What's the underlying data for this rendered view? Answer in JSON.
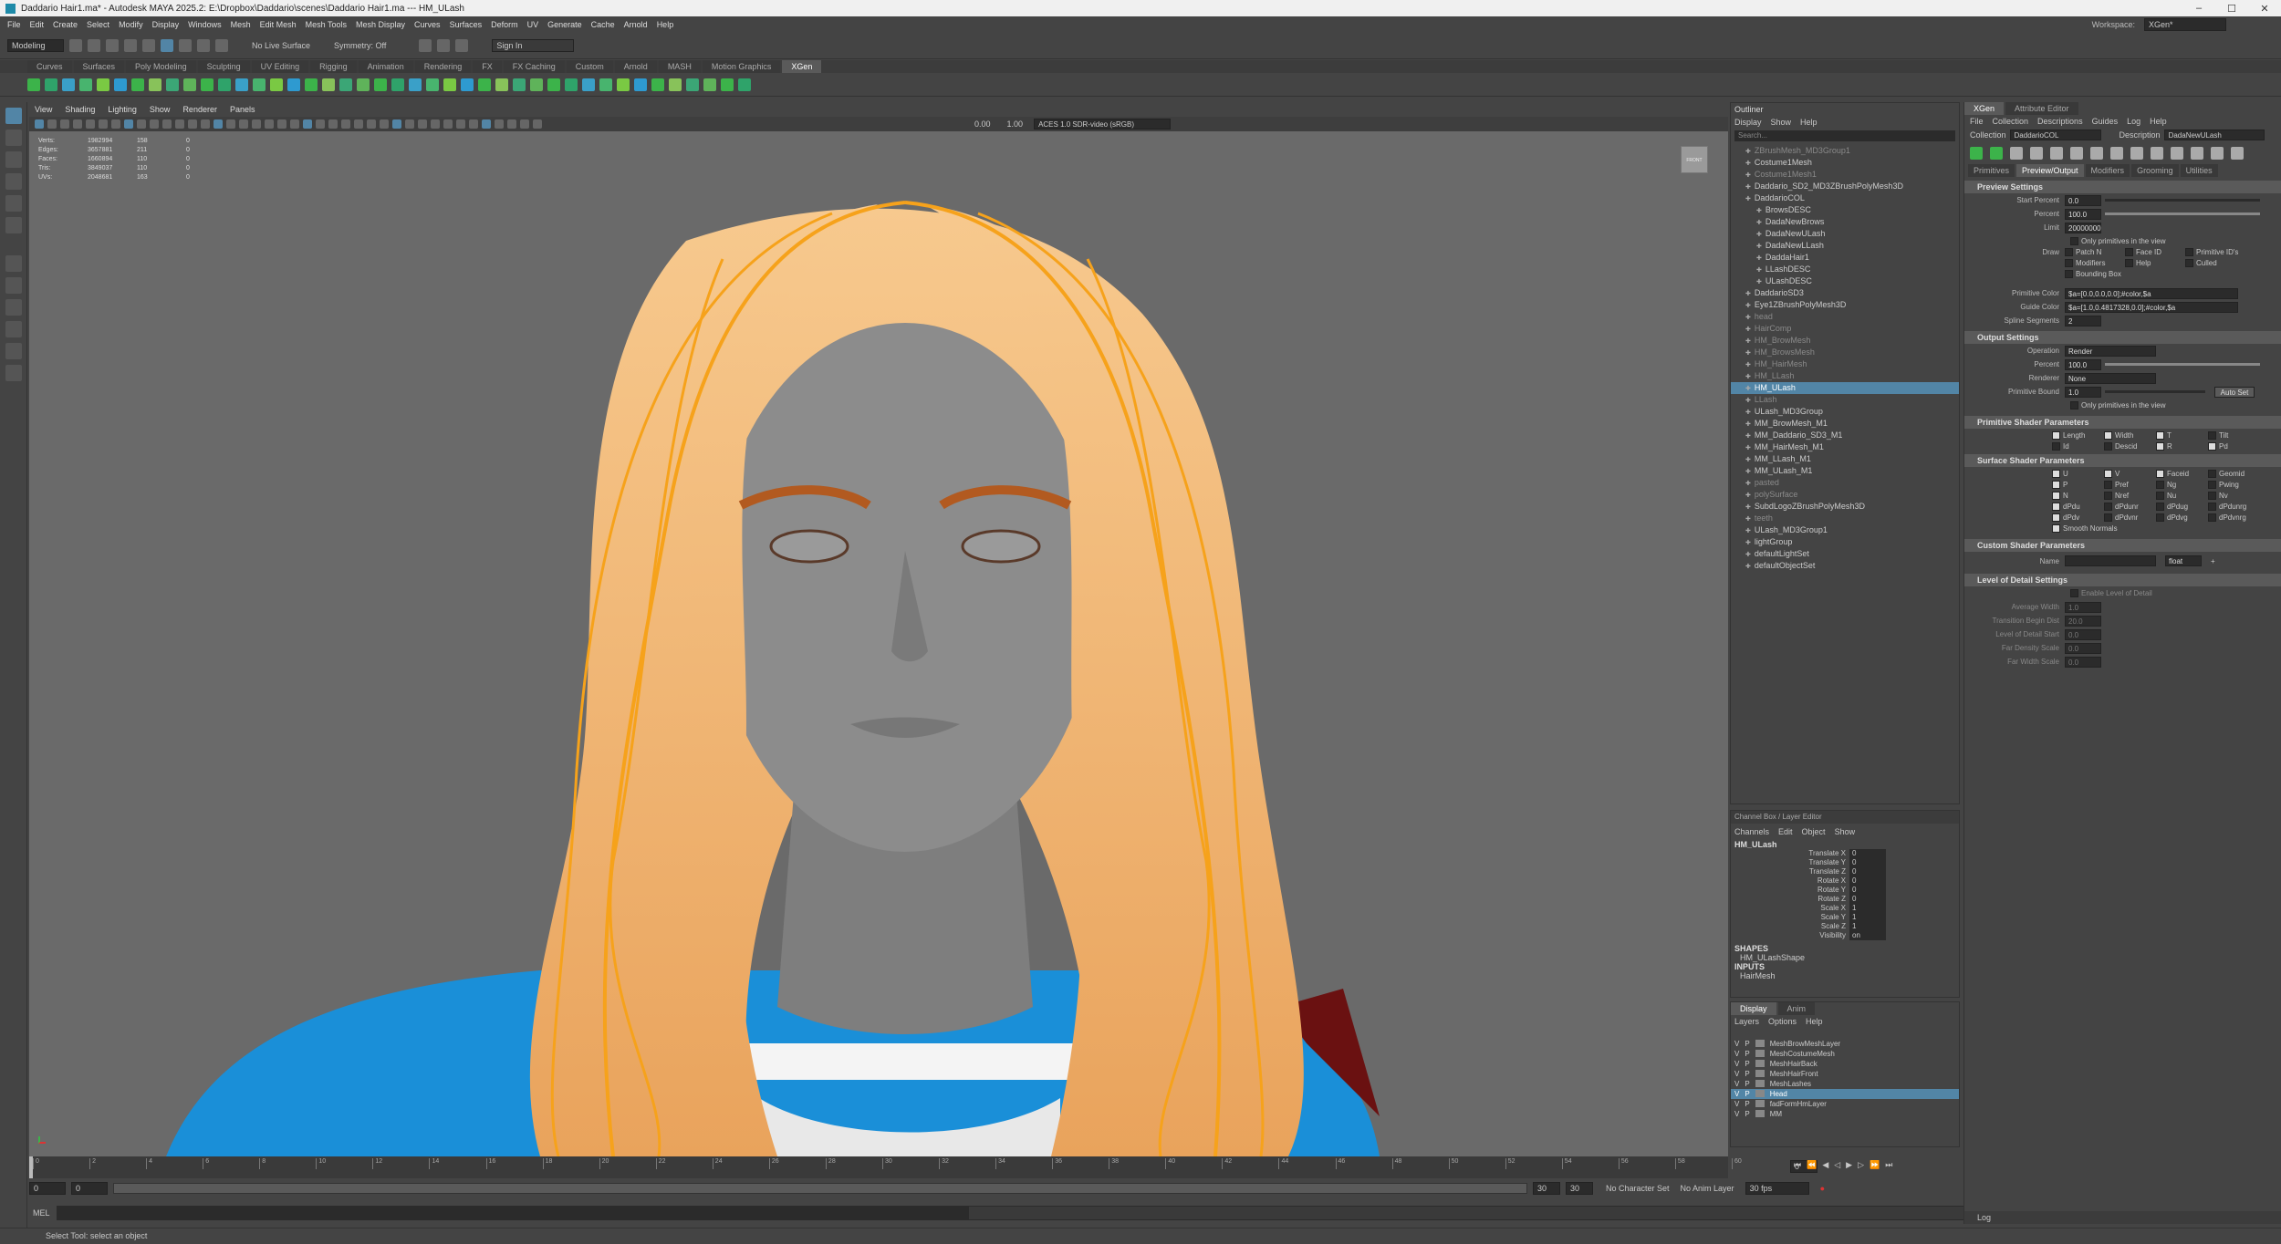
{
  "window": {
    "title": "Daddario Hair1.ma* - Autodesk MAYA 2025.2: E:\\Dropbox\\Daddario\\scenes\\Daddario Hair1.ma --- HM_ULash",
    "min": "–",
    "max": "☐",
    "close": "✕"
  },
  "menubar": {
    "items": [
      "File",
      "Edit",
      "Create",
      "Select",
      "Modify",
      "Display",
      "Windows",
      "Mesh",
      "Edit Mesh",
      "Mesh Tools",
      "Mesh Display",
      "Curves",
      "Surfaces",
      "Deform",
      "UV",
      "Generate",
      "Cache",
      "Arnold",
      "Help"
    ],
    "workspace_label": "Workspace:",
    "workspace_value": "XGen*"
  },
  "statusline": {
    "mode": "Modeling",
    "live": "No Live Surface",
    "symmetry": "Symmetry: Off",
    "user": "Sign In"
  },
  "shelf_tabs": [
    "Curves",
    "Surfaces",
    "Poly Modeling",
    "Sculpting",
    "UV Editing",
    "Rigging",
    "Animation",
    "Rendering",
    "FX",
    "FX Caching",
    "Custom",
    "Arnold",
    "MASH",
    "Motion Graphics",
    "XGen"
  ],
  "shelf_active": "XGen",
  "panel_menu": [
    "View",
    "Shading",
    "Lighting",
    "Show",
    "Renderer",
    "Panels"
  ],
  "panel_toolbar": {
    "val1": "0.00",
    "val2": "1.00",
    "colorspace": "ACES 1.0 SDR-video (sRGB)"
  },
  "hud": [
    [
      "Verts:",
      "1982994",
      "158",
      "0"
    ],
    [
      "Edges:",
      "3657881",
      "211",
      "0"
    ],
    [
      "Faces:",
      "1660894",
      "110",
      "0"
    ],
    [
      "Tris:",
      "3849037",
      "110",
      "0"
    ],
    [
      "UVs:",
      "2048681",
      "163",
      "0"
    ]
  ],
  "viewcube": "FRONT",
  "timeline": {
    "ticks": [
      "0",
      "2",
      "4",
      "6",
      "8",
      "10",
      "12",
      "14",
      "16",
      "18",
      "20",
      "22",
      "24",
      "26",
      "28",
      "30",
      "32",
      "34",
      "36",
      "38",
      "40",
      "42",
      "44",
      "46",
      "48",
      "50",
      "52",
      "54",
      "56",
      "58",
      "60"
    ],
    "current": "0",
    "start": "0",
    "start2": "0",
    "end": "30",
    "end2": "30",
    "charset": "No Character Set",
    "anim": "No Anim Layer",
    "fps": "30 fps"
  },
  "mel": {
    "label": "MEL"
  },
  "helpline": "Select Tool: select an object",
  "outliner": {
    "title": "Outliner",
    "menu": [
      "Display",
      "Show",
      "Help"
    ],
    "search": "Search...",
    "items": [
      {
        "t": "ZBrushMesh_MD3Group1",
        "d": 1,
        "c": "dim"
      },
      {
        "t": "Costume1Mesh",
        "d": 1,
        "c": ""
      },
      {
        "t": "Costume1Mesh1",
        "d": 1,
        "c": "dim"
      },
      {
        "t": "Daddario_SD2_MD3ZBrushPolyMesh3D",
        "d": 1,
        "c": ""
      },
      {
        "t": "DaddarioCOL",
        "d": 1,
        "c": ""
      },
      {
        "t": "BrowsDESC",
        "d": 2,
        "c": ""
      },
      {
        "t": "DadaNewBrows",
        "d": 2,
        "c": ""
      },
      {
        "t": "DadaNewULash",
        "d": 2,
        "c": ""
      },
      {
        "t": "DadaNewLLash",
        "d": 2,
        "c": ""
      },
      {
        "t": "DaddaHair1",
        "d": 2,
        "c": ""
      },
      {
        "t": "LLashDESC",
        "d": 2,
        "c": ""
      },
      {
        "t": "ULashDESC",
        "d": 2,
        "c": ""
      },
      {
        "t": "DaddarioSD3",
        "d": 1,
        "c": ""
      },
      {
        "t": "Eye1ZBrushPolyMesh3D",
        "d": 1,
        "c": ""
      },
      {
        "t": "head",
        "d": 1,
        "c": "dim"
      },
      {
        "t": "HairComp",
        "d": 1,
        "c": "dim"
      },
      {
        "t": "HM_BrowMesh",
        "d": 1,
        "c": "dim"
      },
      {
        "t": "HM_BrowsMesh",
        "d": 1,
        "c": "dim"
      },
      {
        "t": "HM_HairMesh",
        "d": 1,
        "c": "dim"
      },
      {
        "t": "HM_LLash",
        "d": 1,
        "c": "dim"
      },
      {
        "t": "HM_ULash",
        "d": 1,
        "c": "sel"
      },
      {
        "t": "LLash",
        "d": 1,
        "c": "dim"
      },
      {
        "t": "ULash_MD3Group",
        "d": 1,
        "c": ""
      },
      {
        "t": "MM_BrowMesh_M1",
        "d": 1,
        "c": ""
      },
      {
        "t": "MM_Daddario_SD3_M1",
        "d": 1,
        "c": ""
      },
      {
        "t": "MM_HairMesh_M1",
        "d": 1,
        "c": ""
      },
      {
        "t": "MM_LLash_M1",
        "d": 1,
        "c": ""
      },
      {
        "t": "MM_ULash_M1",
        "d": 1,
        "c": ""
      },
      {
        "t": "pasted",
        "d": 1,
        "c": "dim"
      },
      {
        "t": "polySurface",
        "d": 1,
        "c": "dim"
      },
      {
        "t": "SubdLogoZBrushPolyMesh3D",
        "d": 1,
        "c": ""
      },
      {
        "t": "teeth",
        "d": 1,
        "c": "dim"
      },
      {
        "t": "ULash_MD3Group1",
        "d": 1,
        "c": ""
      },
      {
        "t": "lightGroup",
        "d": 1,
        "c": ""
      },
      {
        "t": "defaultLightSet",
        "d": 1,
        "c": ""
      },
      {
        "t": "defaultObjectSet",
        "d": 1,
        "c": ""
      }
    ]
  },
  "channelbox": {
    "header": "Channel Box / Layer Editor",
    "menu": [
      "Channels",
      "Edit",
      "Object",
      "Show"
    ],
    "object": "HM_ULash",
    "channels": [
      [
        "Translate X",
        "0"
      ],
      [
        "Translate Y",
        "0"
      ],
      [
        "Translate Z",
        "0"
      ],
      [
        "Rotate X",
        "0"
      ],
      [
        "Rotate Y",
        "0"
      ],
      [
        "Rotate Z",
        "0"
      ],
      [
        "Scale X",
        "1"
      ],
      [
        "Scale Y",
        "1"
      ],
      [
        "Scale Z",
        "1"
      ],
      [
        "Visibility",
        "on"
      ]
    ],
    "shapes_label": "SHAPES",
    "shape": "HM_ULashShape",
    "inputs_label": "INPUTS",
    "input": "HairMesh"
  },
  "layers": {
    "tabs": [
      "Display",
      "Anim"
    ],
    "menu": [
      "Layers",
      "Options",
      "Help"
    ],
    "items": [
      {
        "t": "MeshBrowMeshLayer",
        "sel": false
      },
      {
        "t": "MeshCostumeMesh",
        "sel": false
      },
      {
        "t": "MeshHairBack",
        "sel": false
      },
      {
        "t": "MeshHairFront",
        "sel": false
      },
      {
        "t": "MeshLashes",
        "sel": false
      },
      {
        "t": "Head",
        "sel": true
      },
      {
        "t": "fadFormHmLayer",
        "sel": false
      },
      {
        "t": "MM",
        "sel": false
      }
    ]
  },
  "xgen": {
    "tabs_top": [
      "XGen",
      "Attribute Editor"
    ],
    "menu": [
      "File",
      "Collection",
      "Descriptions",
      "Guides",
      "Log",
      "Help"
    ],
    "collection_label": "Collection",
    "collection": "DaddarioCOL",
    "description_label": "Description",
    "description": "DadaNewULash",
    "tabs": [
      "Primitives",
      "Preview/Output",
      "Modifiers",
      "Grooming",
      "Utilities"
    ],
    "active_tab": "Preview/Output",
    "preview": {
      "title": "Preview Settings",
      "start_percent_l": "Start Percent",
      "start_percent": "0.0",
      "percent_l": "Percent",
      "percent": "100.0",
      "limit_l": "Limit",
      "limit": "20000000",
      "only_l": "Only primitives in the view",
      "draw_l": "Draw",
      "draw": [
        "Patch N",
        "Face ID",
        "Primitive ID's",
        "Modifiers",
        "Help",
        "Culled",
        "Bounding Box"
      ],
      "prim_color_l": "Primitive Color",
      "prim_color": "$a=[0.0,0.0,0.0];#color,$a",
      "guide_color_l": "Guide Color",
      "guide_color": "$a=[1.0,0.4817328,0.0];#color,$a",
      "spline_l": "Spline Segments",
      "spline": "2"
    },
    "output": {
      "title": "Output Settings",
      "operation_l": "Operation",
      "operation": "Render",
      "percent_l": "Percent",
      "percent": "100.0",
      "renderer_l": "Renderer",
      "renderer": "None",
      "bound_l": "Primitive Bound",
      "bound": "1.0",
      "autoset": "Auto Set",
      "only_l": "Only primitives in the view"
    },
    "prim_shader": {
      "title": "Primitive Shader Parameters",
      "items": [
        "Length",
        "Width",
        "T",
        "Tilt",
        "Id",
        "Descid",
        "R",
        "Pd"
      ]
    },
    "surf_shader": {
      "title": "Surface Shader Parameters",
      "items": [
        "U",
        "V",
        "Faceid",
        "Geomid",
        "P",
        "Pref",
        "Ng",
        "Pwing",
        "N",
        "Nref",
        "Nu",
        "Nv",
        "dPdu",
        "dPdunr",
        "dPdug",
        "dPdunrg",
        "dPdv",
        "dPdvnr",
        "dPdvg",
        "dPdvnrg"
      ],
      "smooth": "Smooth Normals"
    },
    "custom": {
      "title": "Custom Shader Parameters",
      "name_l": "Name",
      "type": "float"
    },
    "lod": {
      "title": "Level of Detail Settings",
      "enable": "Enable Level of Detail",
      "fields": [
        [
          "Average Width",
          "1.0"
        ],
        [
          "Transition Begin Dist",
          "20.0"
        ],
        [
          "Level of Detail Start",
          "0.0"
        ],
        [
          "Far Density Scale",
          "0.0"
        ],
        [
          "Far Width Scale",
          "0.0"
        ]
      ]
    },
    "log_label": "Log"
  },
  "colors": {
    "accent": "#5285a6",
    "hair": "#f2b26a",
    "guide": "#f6a21b",
    "skin": "#8c8c8c",
    "shirt": "#1a8fd8"
  }
}
